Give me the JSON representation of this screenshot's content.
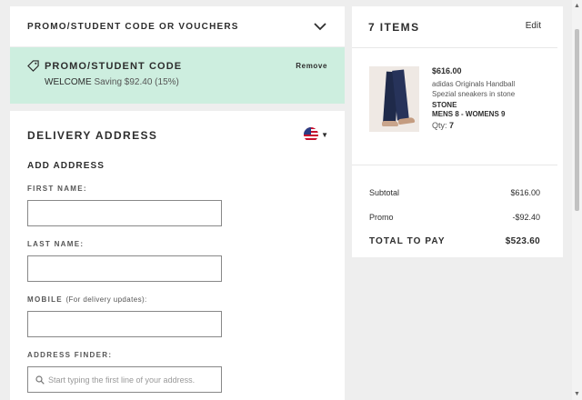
{
  "promo_bar": {
    "title": "PROMO/STUDENT CODE OR VOUCHERS",
    "toggle_icon": "chevron-down-icon"
  },
  "promo_applied": {
    "label": "PROMO/STUDENT CODE",
    "remove": "Remove",
    "code": "WELCOME",
    "saving": "Saving $92.40 (15%)",
    "background": "#cdeedf"
  },
  "delivery": {
    "title": "DELIVERY ADDRESS",
    "country_flag": "us-flag-icon",
    "add_address": "ADD ADDRESS",
    "fields": {
      "first_name": {
        "label": "FIRST NAME:",
        "value": ""
      },
      "last_name": {
        "label": "LAST NAME:",
        "value": ""
      },
      "mobile": {
        "label": "MOBILE",
        "hint": "(For delivery updates):",
        "value": ""
      },
      "address_finder": {
        "label": "ADDRESS FINDER:",
        "placeholder": "Start typing the first line of your address."
      }
    }
  },
  "summary": {
    "items_title": "7 ITEMS",
    "edit": "Edit",
    "product": {
      "price": "$616.00",
      "name": "adidas Originals Handball Spezial sneakers in stone",
      "variant_color": "STONE",
      "variant_size": "MENS 8 - WOMENS 9",
      "qty_label": "Qty:",
      "qty_value": "7"
    },
    "subtotal_label": "Subtotal",
    "subtotal": "$616.00",
    "promo_label": "Promo",
    "promo": "-$92.40",
    "total_label": "TOTAL TO PAY",
    "total": "$523.60"
  }
}
